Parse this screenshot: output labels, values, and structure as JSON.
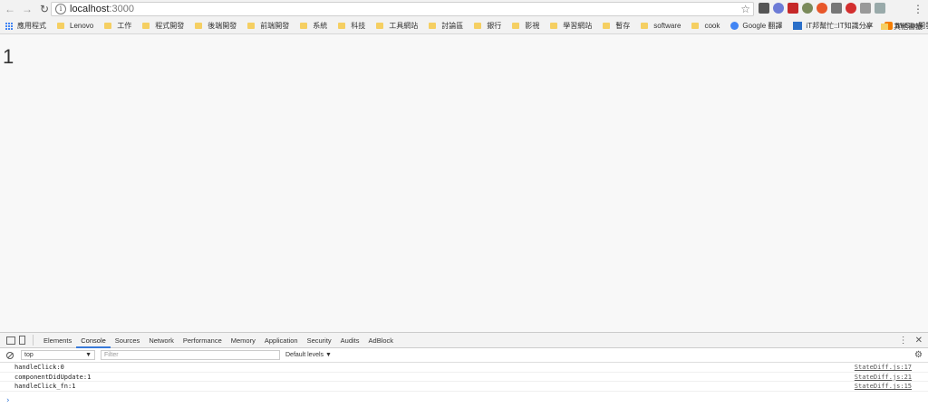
{
  "browser": {
    "url_host": "localhost",
    "url_port": ":3000"
  },
  "bookmarks": {
    "apps_label": "應用程式",
    "items": [
      {
        "label": "Lenovo",
        "icon": "folder-icon"
      },
      {
        "label": "工作",
        "icon": "folder-icon"
      },
      {
        "label": "程式開發",
        "icon": "folder-icon"
      },
      {
        "label": "後端開發",
        "icon": "folder-icon"
      },
      {
        "label": "前端開發",
        "icon": "folder-icon"
      },
      {
        "label": "系統",
        "icon": "folder-icon"
      },
      {
        "label": "科技",
        "icon": "folder-icon"
      },
      {
        "label": "工具網站",
        "icon": "folder-icon"
      },
      {
        "label": "討論區",
        "icon": "folder-icon"
      },
      {
        "label": "銀行",
        "icon": "folder-icon"
      },
      {
        "label": "影視",
        "icon": "folder-icon"
      },
      {
        "label": "學習網站",
        "icon": "folder-icon"
      },
      {
        "label": "暫存",
        "icon": "folder-icon"
      },
      {
        "label": "software",
        "icon": "folder-icon"
      },
      {
        "label": "cook",
        "icon": "folder-icon"
      }
    ],
    "google_translate": "Google 翻譯",
    "ithome": "iT邦幫忙::IT知識分享",
    "miisoo": "MiiSoo開發日誌: MS",
    "more": "»",
    "other_bookmarks": "其他書籤"
  },
  "page": {
    "counter": "1"
  },
  "devtools": {
    "tabs": [
      "Elements",
      "Console",
      "Sources",
      "Network",
      "Performance",
      "Memory",
      "Application",
      "Security",
      "Audits",
      "AdBlock"
    ],
    "active_tab": "Console",
    "context": "top",
    "filter_placeholder": "Filter",
    "levels": "Default levels ▼",
    "logs": [
      {
        "message": "handleClick:0",
        "source": "StateDiff.js:17"
      },
      {
        "message": "componentDidUpdate:1",
        "source": "StateDiff.js:21"
      },
      {
        "message": "handleClick_fn:1",
        "source": "StateDiff.js:15"
      }
    ],
    "prompt": "›"
  }
}
